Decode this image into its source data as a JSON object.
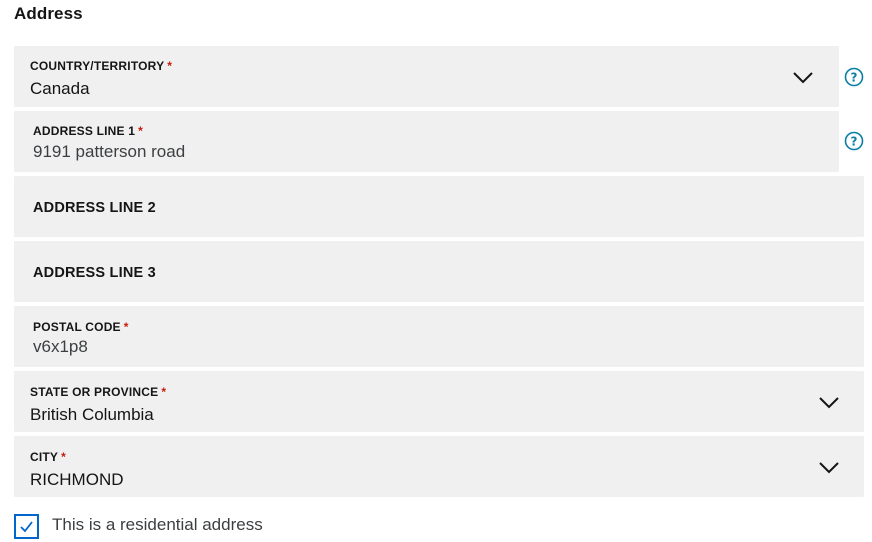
{
  "section": {
    "title": "Address"
  },
  "required_marker": "*",
  "fields": {
    "country": {
      "label": "Country/Territory",
      "value": "Canada"
    },
    "address1": {
      "label": "Address line 1",
      "value": "9191 patterson road"
    },
    "address2": {
      "label": "Address line 2",
      "value": ""
    },
    "address3": {
      "label": "Address line 3",
      "value": ""
    },
    "postal": {
      "label": "Postal code",
      "value": "v6x1p8"
    },
    "state": {
      "label": "State or province",
      "value": "British Columbia"
    },
    "city": {
      "label": "City",
      "value": "RICHMOND"
    }
  },
  "residential": {
    "label": "This is a residential address",
    "checked": true
  },
  "colors": {
    "accent": "#0066cc",
    "required": "#c9190b",
    "field_bg": "#f0f0f0",
    "help_icon": "#0b7ea6"
  },
  "icons": {
    "dropdown": "chevron-down-icon",
    "help": "help-circle-icon",
    "check": "checkmark-icon"
  }
}
